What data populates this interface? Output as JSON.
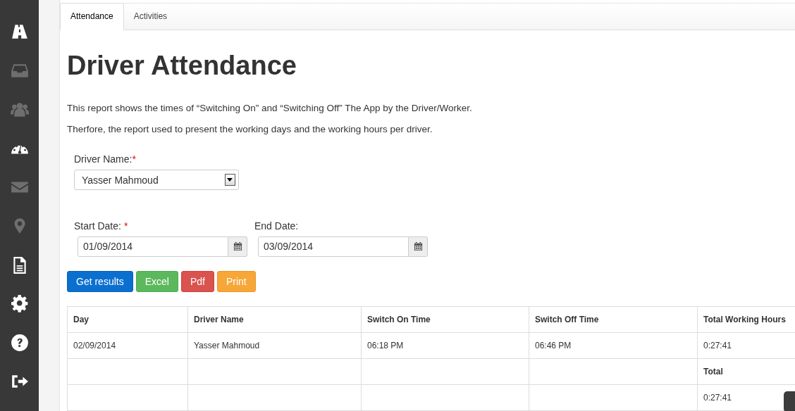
{
  "sidebar": {
    "items": [
      {
        "disabled": false
      },
      {
        "disabled": true
      },
      {
        "disabled": true
      },
      {
        "disabled": false
      },
      {
        "disabled": true
      },
      {
        "disabled": true
      },
      {
        "disabled": false
      },
      {
        "disabled": false
      },
      {
        "disabled": false
      },
      {
        "disabled": false
      }
    ]
  },
  "tabs": [
    {
      "label": "Attendance",
      "selected": true
    },
    {
      "label": "Activities",
      "selected": false
    }
  ],
  "title": "Driver Attendance",
  "description": [
    "This report shows the times of “Switching On” and “Switching Off” The App by the Driver/Worker.",
    "Therfore, the report used to present the working days and the working hours per driver."
  ],
  "driver_field": {
    "label": "Driver Name:",
    "required_mark": "*",
    "value": "Yasser Mahmoud"
  },
  "date_fields": [
    {
      "label": "Start Date:",
      "required_mark": "*",
      "value": "01/09/2014"
    },
    {
      "label": "End Date:",
      "value": "03/09/2014"
    }
  ],
  "buttons": [
    {
      "label": "Get results",
      "kind": "primary"
    },
    {
      "label": "Excel",
      "kind": "success"
    },
    {
      "label": "Pdf",
      "kind": "danger"
    },
    {
      "label": "Print",
      "kind": "warning"
    }
  ],
  "table": {
    "columns": [
      "Day",
      "Driver Name",
      "Switch On Time",
      "Switch Off Time",
      "Total Working Hours"
    ],
    "rows": [
      {
        "kind": "data",
        "cells": [
          "02/09/2014",
          "Yasser Mahmoud",
          "06:18 PM",
          "06:46 PM",
          "0:27:41"
        ]
      },
      {
        "kind": "total_label",
        "cells": [
          "Total"
        ]
      },
      {
        "kind": "total_value",
        "cells": [
          "0:27:41"
        ]
      }
    ]
  }
}
